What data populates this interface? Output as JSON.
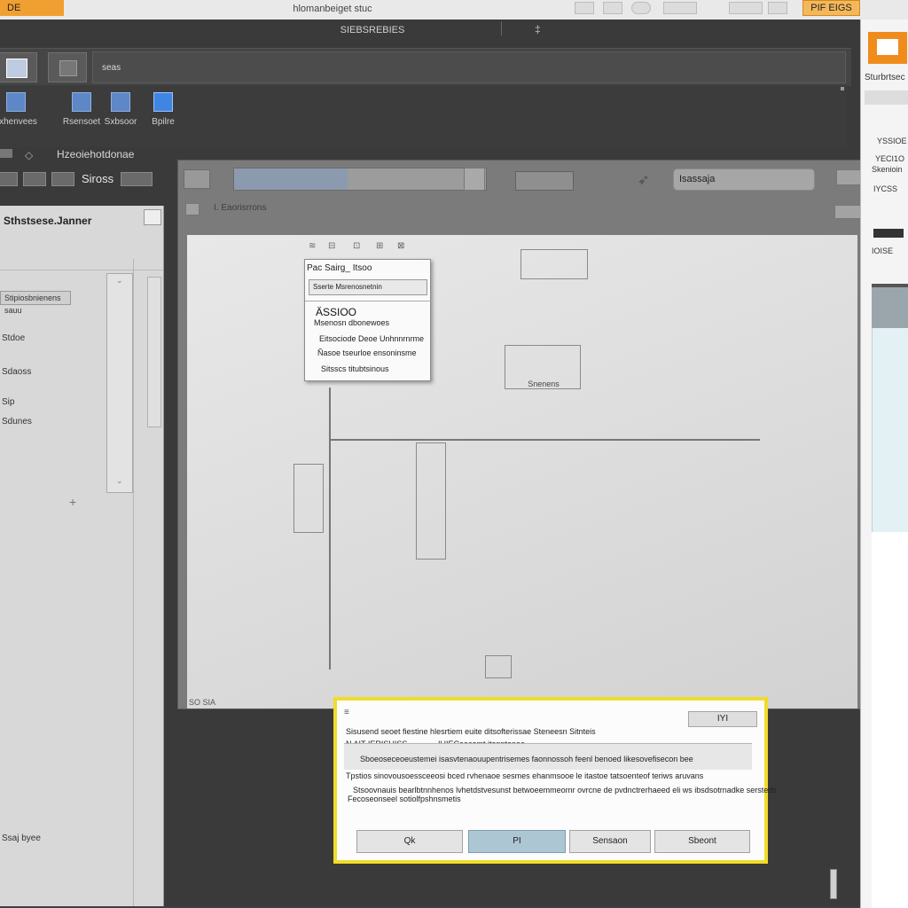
{
  "topbar": {
    "left_badge": "DE",
    "title": "hlomanbeiget stuc",
    "right_badge": "PIF EIGS"
  },
  "window": {
    "title": "SIEBSREBIES",
    "ribbon_text": "seas",
    "toolbar_items": [
      {
        "label": "sxhenvees",
        "icon": "grid-icon"
      },
      {
        "label": "Rsensoet",
        "icon": "table-icon"
      },
      {
        "label": "Sxbsoor",
        "icon": "table-icon"
      },
      {
        "label": "Bpilre",
        "icon": "app-icon"
      }
    ],
    "toolbar_row2_label": "Hzeoiehotdonae",
    "status_label": "Siross"
  },
  "left_panel": {
    "title": "Sthstsese.Janner",
    "chip": "Stipiosbnienens sauu",
    "items": [
      "Stdoe",
      "Sdaoss",
      "Sip",
      "Sdunes"
    ],
    "bottom_label": "Ssaj byee"
  },
  "dialog": {
    "search_value": "Isassaja",
    "progress_fraction": 0.45,
    "sub_label": "I. Eaorisrrons",
    "canvas_box_label": "Snenens",
    "canvas_footer": "SO SIA"
  },
  "popup": {
    "title": "Pac  Sairg_  Itsoo",
    "field": "Sserte  Msrenosnetnin",
    "heading": "ÄSSIOO",
    "items": [
      "Msenosn dbonewoes",
      "Eitsociode Deoe Unhnnrnrme",
      "Ñasoe tseurloe  ensoninsme",
      "Sitsscs titubtsinous"
    ]
  },
  "bottom_dialog": {
    "top_button": "IYI",
    "line1": "Sisusend seoet fiestine hlesrtiem euite ditsofterissae Steneesn Sitnteis",
    "line2_left": "N AIT IERISHISS",
    "line2_right": "IHIECeecomt itanntenae",
    "field_text": "Sboeoseceoeustemei isasvtenaouupentrisemes faonnossoh feenl benoed likesovefisecon bee",
    "line3": "Tpstios sinovousoessceeosi bced rvhenaoe sesmes ehanmsooe  le  itastoe  tatsoenteof teriws aruvans",
    "line4": "Stsoovnauis bearlbtnnhenos lvhetdstvesunst betwoeemmeornr ovrcne de pvdnctrerhaeed  eli ws ibsdsotrnadke  sersteds",
    "line5": "Fecoseonseel sotiolfpshnsmetis",
    "buttons": [
      "Qk",
      "PI",
      "Sensaon",
      "Sbeont"
    ]
  },
  "right_strip": {
    "label": "Sturbrtsec",
    "lines": [
      "YSSIOE",
      "YECI1O",
      "Skenioin",
      "IYCSS",
      "IOISE"
    ]
  }
}
